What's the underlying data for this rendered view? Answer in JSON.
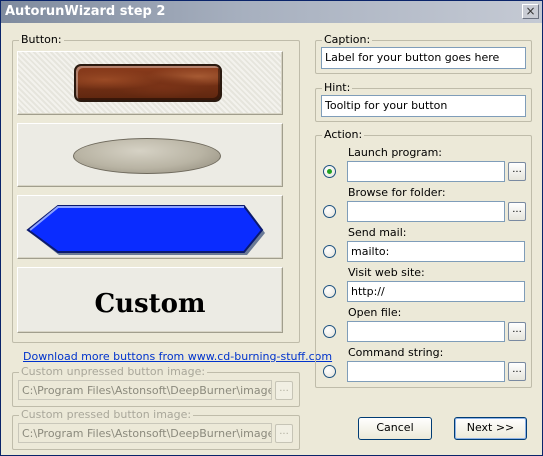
{
  "window": {
    "title": "AutorunWizard step 2",
    "close_glyph": "×"
  },
  "button_group": {
    "legend": "Button:",
    "tiles": [
      {
        "name": "brick",
        "selected": true
      },
      {
        "name": "stone",
        "selected": false
      },
      {
        "name": "hexagon",
        "selected": false
      },
      {
        "name": "custom",
        "label": "Custom"
      }
    ]
  },
  "download_link": "Download more buttons from www.cd-burning-stuff.com",
  "unpressed": {
    "legend": "Custom unpressed button image:",
    "value": "C:\\Program Files\\Astonsoft\\DeepBurner\\images\\But",
    "browse": "..."
  },
  "pressed": {
    "legend": "Custom pressed button image:",
    "value": "C:\\Program Files\\Astonsoft\\DeepBurner\\images\\But",
    "browse": "..."
  },
  "caption": {
    "legend": "Caption:",
    "value": "Label for your button goes here"
  },
  "hint": {
    "legend": "Hint:",
    "value": "Tooltip for your button"
  },
  "action": {
    "legend": "Action:",
    "selected": "launch",
    "items": [
      {
        "id": "launch",
        "label": "Launch program:",
        "value": "",
        "browse": "..."
      },
      {
        "id": "folder",
        "label": "Browse for folder:",
        "value": "",
        "browse": "..."
      },
      {
        "id": "mail",
        "label": "Send mail:",
        "value": "mailto:"
      },
      {
        "id": "web",
        "label": "Visit web site:",
        "value": "http://"
      },
      {
        "id": "file",
        "label": "Open file:",
        "value": "",
        "browse": "..."
      },
      {
        "id": "cmd",
        "label": "Command string:",
        "value": "",
        "browse": "..."
      }
    ]
  },
  "footer": {
    "cancel": "Cancel",
    "next": "Next >>"
  },
  "colors": {
    "link": "#0033cc",
    "hexagon_fill": "#0a2cff",
    "radio_dot": "#21a121"
  }
}
